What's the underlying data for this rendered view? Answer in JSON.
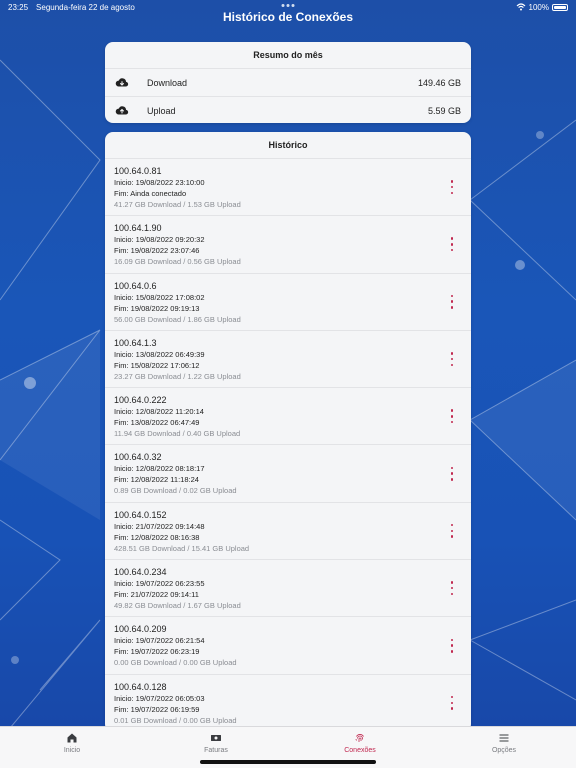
{
  "status": {
    "time": "23:25",
    "date": "Segunda-feira 22 de agosto",
    "battery": "100%"
  },
  "nav": {
    "title": "Histórico de Conexões"
  },
  "summary": {
    "title": "Resumo do mês",
    "rows": [
      {
        "label": "Download",
        "value": "149.46 GB",
        "icon": "cloud-download-icon"
      },
      {
        "label": "Upload",
        "value": "5.59 GB",
        "icon": "cloud-upload-icon"
      }
    ]
  },
  "history": {
    "title": "Histórico",
    "items": [
      {
        "ip": "100.64.0.81",
        "start": "Inicio: 19/08/2022 23:10:00",
        "end": "Fim: Ainda conectado",
        "usage": "41.27 GB Download / 1.53 GB Upload"
      },
      {
        "ip": "100.64.1.90",
        "start": "Inicio: 19/08/2022 09:20:32",
        "end": "Fim: 19/08/2022 23:07:46",
        "usage": "16.09 GB Download / 0.56 GB Upload"
      },
      {
        "ip": "100.64.0.6",
        "start": "Inicio: 15/08/2022 17:08:02",
        "end": "Fim: 19/08/2022 09:19:13",
        "usage": "56.00 GB Download / 1.86 GB Upload"
      },
      {
        "ip": "100.64.1.3",
        "start": "Inicio: 13/08/2022 06:49:39",
        "end": "Fim: 15/08/2022 17:06:12",
        "usage": "23.27 GB Download / 1.22 GB Upload"
      },
      {
        "ip": "100.64.0.222",
        "start": "Inicio: 12/08/2022 11:20:14",
        "end": "Fim: 13/08/2022 06:47:49",
        "usage": "11.94 GB Download / 0.40 GB Upload"
      },
      {
        "ip": "100.64.0.32",
        "start": "Inicio: 12/08/2022 08:18:17",
        "end": "Fim: 12/08/2022 11:18:24",
        "usage": "0.89 GB Download / 0.02 GB Upload"
      },
      {
        "ip": "100.64.0.152",
        "start": "Inicio: 21/07/2022 09:14:48",
        "end": "Fim: 12/08/2022 08:16:38",
        "usage": "428.51 GB Download / 15.41 GB Upload"
      },
      {
        "ip": "100.64.0.234",
        "start": "Inicio: 19/07/2022 06:23:55",
        "end": "Fim: 21/07/2022 09:14:11",
        "usage": "49.82 GB Download / 1.67 GB Upload"
      },
      {
        "ip": "100.64.0.209",
        "start": "Inicio: 19/07/2022 06:21:54",
        "end": "Fim: 19/07/2022 06:23:19",
        "usage": "0.00 GB Download / 0.00 GB Upload"
      },
      {
        "ip": "100.64.0.128",
        "start": "Inicio: 19/07/2022 06:05:03",
        "end": "Fim: 19/07/2022 06:19:59",
        "usage": "0.01 GB Download / 0.00 GB Upload"
      }
    ]
  },
  "tabs": [
    {
      "label": "Inicio",
      "icon": "home-icon",
      "active": false
    },
    {
      "label": "Faturas",
      "icon": "money-icon",
      "active": false
    },
    {
      "label": "Conexões",
      "icon": "fingerprint-icon",
      "active": true
    },
    {
      "label": "Opções",
      "icon": "menu-icon",
      "active": false
    }
  ],
  "colors": {
    "accent": "#c0274f",
    "background": "#1a56b8",
    "card": "#f4f5f7"
  }
}
